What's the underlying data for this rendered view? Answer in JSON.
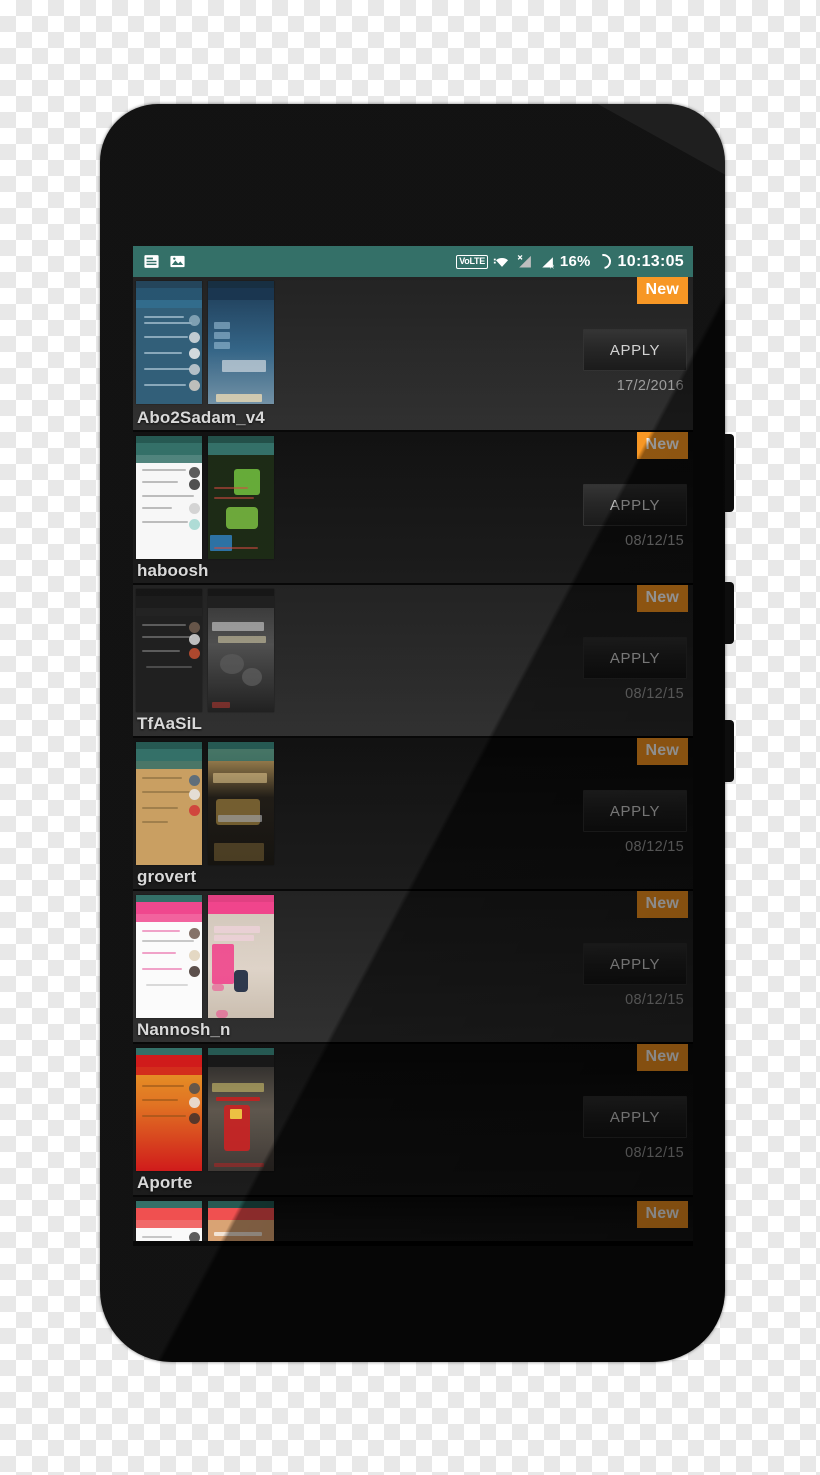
{
  "statusbar": {
    "notification_icons": [
      "document-icon",
      "gallery-image-icon"
    ],
    "volte_label": "VoLTE",
    "wifi_icon": "wifi-icon",
    "signal_icon_1": "signal-no-service-icon",
    "signal_icon_2": "signal-roaming-icon",
    "battery_percent": "16%",
    "battery_icon": "battery-ring-icon",
    "clock": "10:13:05",
    "background_color": "#2d6b63"
  },
  "theme": {
    "accent_orange": "#f7941e",
    "screen_background": "#000000",
    "row_background": "#1c1c1c",
    "name_color": "#d8d8d8",
    "date_color": "#9a9a9a"
  },
  "labels": {
    "apply": "APPLY",
    "new_badge": "New"
  },
  "list": {
    "items": [
      {
        "name": "Abo2Sadam_v4",
        "date": "17/2/2016",
        "apply": "APPLY",
        "badge": "New",
        "thumb1_color": "#2b5a75",
        "thumb1_accent": "#1d3f56",
        "thumb2_color": "#1b3d5c",
        "thumb2_accent": "#3b6e92"
      },
      {
        "name": "haboosh",
        "date": "08/12/15",
        "apply": "APPLY",
        "badge": "New",
        "thumb1_color": "#f5f5f5",
        "thumb1_accent": "#2d6b63",
        "thumb2_color": "#17270f",
        "thumb2_accent": "#4f9c2d"
      },
      {
        "name": "TfAaSiL",
        "date": "08/12/15",
        "apply": "APPLY",
        "badge": "New",
        "thumb1_color": "#1a1a1a",
        "thumb1_accent": "#2f2f2f",
        "thumb2_color": "#3a3a3a",
        "thumb2_accent": "#5a5a5a"
      },
      {
        "name": "grovert",
        "date": "08/12/15",
        "apply": "APPLY",
        "badge": "New",
        "thumb1_color": "#c79c5d",
        "thumb1_accent": "#2d6b63",
        "thumb2_color": "#2a2113",
        "thumb2_accent": "#b8913f"
      },
      {
        "name": "Nannosh_n",
        "date": "08/12/15",
        "apply": "APPLY",
        "badge": "New",
        "thumb1_color": "#fafafa",
        "thumb1_accent": "#f0428a",
        "thumb2_color": "#d6c7bb",
        "thumb2_accent": "#ef3f88"
      },
      {
        "name": "Aporte",
        "date": "08/12/15",
        "apply": "APPLY",
        "badge": "New",
        "thumb1_color": "#e0701c",
        "thumb1_accent": "#cf1414",
        "thumb2_color": "#4a4340",
        "thumb2_accent": "#b01b1b"
      },
      {
        "name": "",
        "date": "",
        "apply": "",
        "badge": "New",
        "thumb1_color": "#ef4a4a",
        "thumb1_accent": "#d83030",
        "thumb2_color": "#d8a070",
        "thumb2_accent": "#ef4a4a"
      }
    ]
  }
}
